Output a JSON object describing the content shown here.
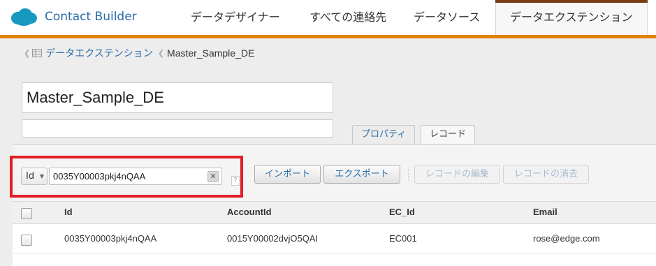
{
  "header": {
    "app_title": "Contact Builder",
    "tabs": [
      {
        "label": "データデザイナー"
      },
      {
        "label": "すべての連絡先"
      },
      {
        "label": "データソース"
      },
      {
        "label": "データエクステンション",
        "active": true
      }
    ],
    "brand_accent": "#e0820f",
    "active_tab_accent": "#7a3b12"
  },
  "breadcrumb": {
    "parent": "データエクステンション",
    "current": "Master_Sample_DE"
  },
  "extension": {
    "name": "Master_Sample_DE",
    "description": ""
  },
  "subtabs": [
    {
      "label": "プロパティ"
    },
    {
      "label": "レコード",
      "selected": true
    }
  ],
  "filter": {
    "field": "Id",
    "value": "0035Y00003pkj4nQAA",
    "clear_symbol": "✕",
    "help_symbol": "?"
  },
  "actions": {
    "import": "インポート",
    "export": "エクスポート",
    "edit": "レコードの編集",
    "delete": "レコードの消去"
  },
  "table": {
    "columns": [
      "Id",
      "AccountId",
      "EC_Id",
      "Email"
    ],
    "rows": [
      [
        "0035Y00003pkj4nQAA",
        "0015Y00002dvjO5QAI",
        "EC001",
        "rose@edge.com"
      ]
    ]
  },
  "highlight_color": "#e21f26"
}
